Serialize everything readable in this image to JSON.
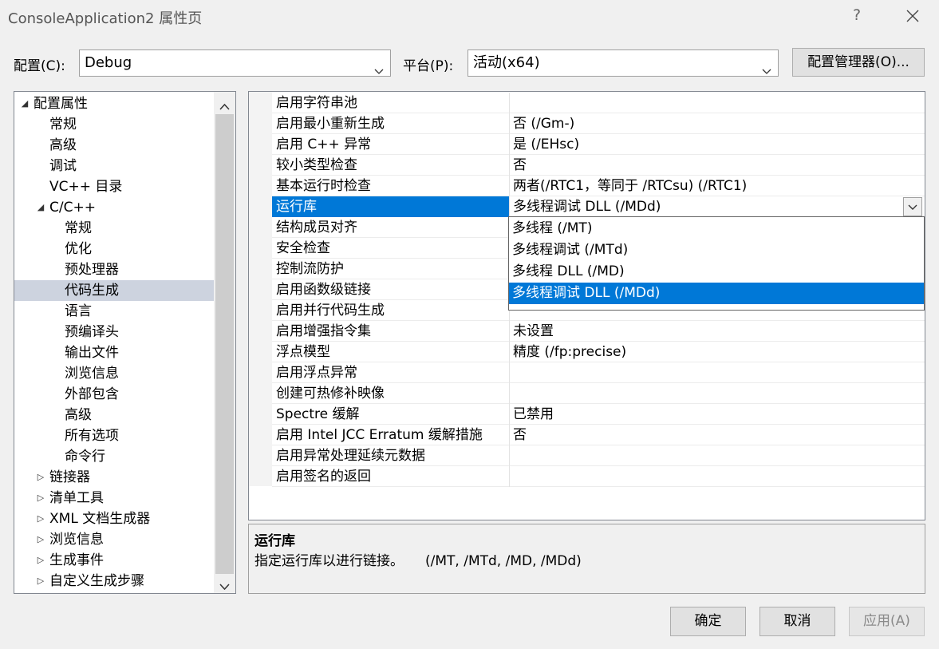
{
  "window": {
    "title": "ConsoleApplication2 属性页",
    "help_label": "?",
    "close_icon": "close-icon"
  },
  "config": {
    "config_label": "配置(C):",
    "config_value": "Debug",
    "platform_label": "平台(P):",
    "platform_value": "活动(x64)",
    "manager_button": "配置管理器(O)..."
  },
  "tree": {
    "items": [
      {
        "label": "配置属性",
        "level": 0,
        "state": "expanded"
      },
      {
        "label": "常规",
        "level": 1
      },
      {
        "label": "高级",
        "level": 1
      },
      {
        "label": "调试",
        "level": 1
      },
      {
        "label": "VC++ 目录",
        "level": 1
      },
      {
        "label": "C/C++",
        "level": 1,
        "state": "expanded"
      },
      {
        "label": "常规",
        "level": 2
      },
      {
        "label": "优化",
        "level": 2
      },
      {
        "label": "预处理器",
        "level": 2
      },
      {
        "label": "代码生成",
        "level": 2,
        "selected": true
      },
      {
        "label": "语言",
        "level": 2
      },
      {
        "label": "预编译头",
        "level": 2
      },
      {
        "label": "输出文件",
        "level": 2
      },
      {
        "label": "浏览信息",
        "level": 2
      },
      {
        "label": "外部包含",
        "level": 2
      },
      {
        "label": "高级",
        "level": 2
      },
      {
        "label": "所有选项",
        "level": 2
      },
      {
        "label": "命令行",
        "level": 2
      },
      {
        "label": "链接器",
        "level": 1,
        "state": "collapsed"
      },
      {
        "label": "清单工具",
        "level": 1,
        "state": "collapsed"
      },
      {
        "label": "XML 文档生成器",
        "level": 1,
        "state": "collapsed"
      },
      {
        "label": "浏览信息",
        "level": 1,
        "state": "collapsed"
      },
      {
        "label": "生成事件",
        "level": 1,
        "state": "collapsed"
      },
      {
        "label": "自定义生成步骤",
        "level": 1,
        "state": "collapsed"
      }
    ]
  },
  "properties": [
    {
      "name": "启用字符串池",
      "value": ""
    },
    {
      "name": "启用最小重新生成",
      "value": "否 (/Gm-)"
    },
    {
      "name": "启用 C++ 异常",
      "value": "是 (/EHsc)"
    },
    {
      "name": "较小类型检查",
      "value": "否"
    },
    {
      "name": "基本运行时检查",
      "value": "两者(/RTC1，等同于 /RTCsu) (/RTC1)"
    },
    {
      "name": "运行库",
      "value": "多线程调试 DLL (/MDd)",
      "selected": true
    },
    {
      "name": "结构成员对齐",
      "value": ""
    },
    {
      "name": "安全检查",
      "value": ""
    },
    {
      "name": "控制流防护",
      "value": ""
    },
    {
      "name": "启用函数级链接",
      "value": ""
    },
    {
      "name": "启用并行代码生成",
      "value": ""
    },
    {
      "name": "启用增强指令集",
      "value": "未设置"
    },
    {
      "name": "浮点模型",
      "value": "精度 (/fp:precise)"
    },
    {
      "name": "启用浮点异常",
      "value": ""
    },
    {
      "name": "创建可热修补映像",
      "value": ""
    },
    {
      "name": "Spectre 缓解",
      "value": "已禁用"
    },
    {
      "name": "启用 Intel JCC Erratum 缓解措施",
      "value": "否"
    },
    {
      "name": "启用异常处理延续元数据",
      "value": ""
    },
    {
      "name": "启用签名的返回",
      "value": ""
    }
  ],
  "dropdown": {
    "options": [
      "多线程 (/MT)",
      "多线程调试 (/MTd)",
      "多线程 DLL (/MD)",
      "多线程调试 DLL (/MDd)"
    ],
    "selected": "多线程调试 DLL (/MDd)"
  },
  "description": {
    "title": "运行库",
    "text": "指定运行库以进行链接。     (/MT, /MTd, /MD, /MDd)"
  },
  "buttons": {
    "ok": "确定",
    "cancel": "取消",
    "apply": "应用(A)"
  },
  "colors": {
    "selection": "#0078d7",
    "tree_selection": "#cdd3df"
  }
}
